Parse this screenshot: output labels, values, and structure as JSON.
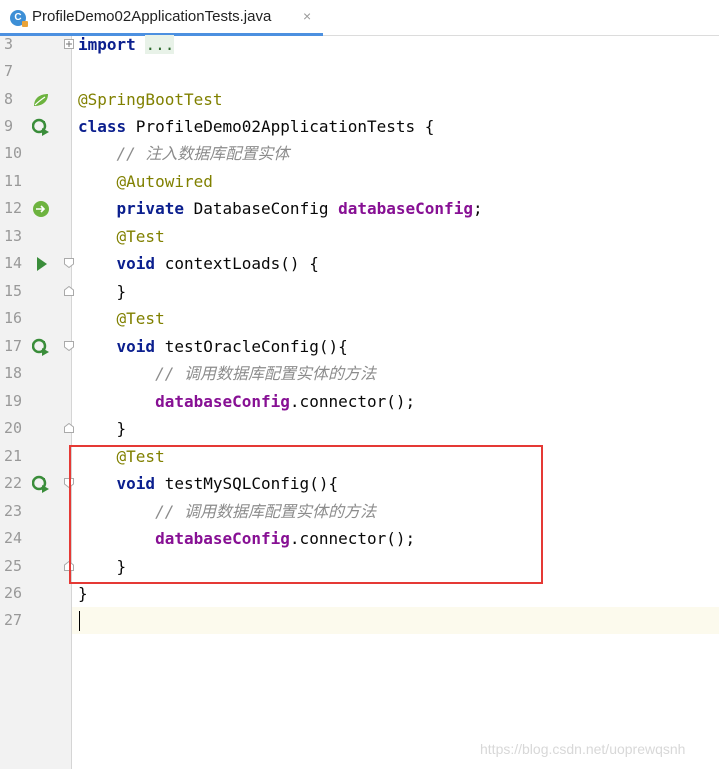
{
  "tab": {
    "title": "ProfileDemo02ApplicationTests.java",
    "icon_letter": "C",
    "close": "×"
  },
  "lines": [
    {
      "num": "3",
      "text": "import ..."
    },
    {
      "num": "7",
      "text": ""
    },
    {
      "num": "8",
      "text": "@SpringBootTest"
    },
    {
      "num": "9",
      "text": "class ProfileDemo02ApplicationTests {"
    },
    {
      "num": "10",
      "text": "    // 注入数据库配置实体"
    },
    {
      "num": "11",
      "text": "    @Autowired"
    },
    {
      "num": "12",
      "text": "    private DatabaseConfig databaseConfig;"
    },
    {
      "num": "13",
      "text": "    @Test"
    },
    {
      "num": "14",
      "text": "    void contextLoads() {"
    },
    {
      "num": "15",
      "text": "    }"
    },
    {
      "num": "16",
      "text": "    @Test"
    },
    {
      "num": "17",
      "text": "    void testOracleConfig(){"
    },
    {
      "num": "18",
      "text": "        // 调用数据库配置实体的方法"
    },
    {
      "num": "19",
      "text": "        databaseConfig.connector();"
    },
    {
      "num": "20",
      "text": "    }"
    },
    {
      "num": "21",
      "text": "    @Test"
    },
    {
      "num": "22",
      "text": "    void testMySQLConfig(){"
    },
    {
      "num": "23",
      "text": "        // 调用数据库配置实体的方法"
    },
    {
      "num": "24",
      "text": "        databaseConfig.connector();"
    },
    {
      "num": "25",
      "text": "    }"
    },
    {
      "num": "26",
      "text": "}"
    },
    {
      "num": "27",
      "text": ""
    }
  ],
  "tokens": {
    "l3_kw": "import",
    "l3_fold": "...",
    "l8_ann": "@SpringBootTest",
    "l9_kw": "class",
    "l9_rest": " ProfileDemo02ApplicationTests {",
    "l10_cmt": "// 注入数据库配置实体",
    "l11_ann": "@Autowired",
    "l12_kw": "private",
    "l12_type": " DatabaseConfig ",
    "l12_fld": "databaseConfig",
    "l12_end": ";",
    "l13_ann": "@Test",
    "l14_kw": "void",
    "l14_rest": " contextLoads() {",
    "l15_rest": "}",
    "l16_ann": "@Test",
    "l17_kw": "void",
    "l17_rest": " testOracleConfig(){",
    "l18_cmt": "// 调用数据库配置实体的方法",
    "l19_fld": "databaseConfig",
    "l19_rest": ".connector();",
    "l20_rest": "}",
    "l21_ann": "@Test",
    "l22_kw": "void",
    "l22_rest": " testMySQLConfig(){",
    "l23_cmt": "// 调用数据库配置实体的方法",
    "l24_fld": "databaseConfig",
    "l24_rest": ".connector();",
    "l25_rest": "}",
    "l26_rest": "}"
  },
  "gutter_icons": {
    "8": "spring-bean-icon",
    "9": "run-test-class-icon",
    "12": "autowired-bean-icon",
    "14": "run-icon",
    "17": "run-test-icon",
    "22": "run-test-icon"
  },
  "colors": {
    "keyword": "#0b1f8e",
    "annotation": "#808000",
    "comment": "#8c8c8c",
    "field": "#871094",
    "highlight_box": "#e53935",
    "tab_underline": "#4c90e0"
  },
  "watermark": "https://blog.csdn.net/uoprewqsnh"
}
